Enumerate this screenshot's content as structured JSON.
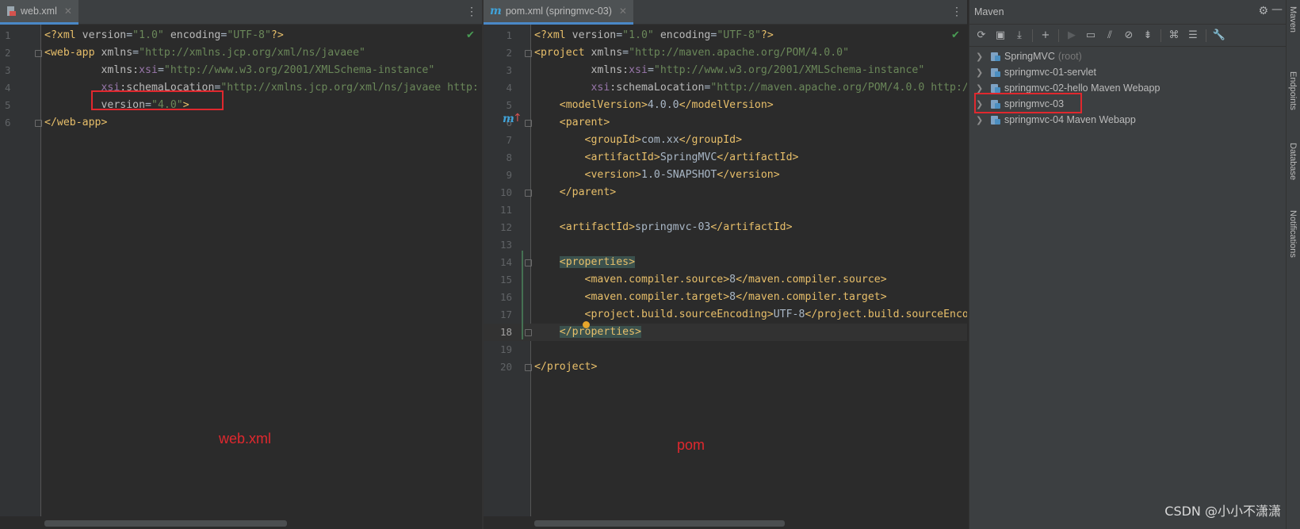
{
  "left_editor": {
    "tab_label": "web.xml",
    "lines": [
      {
        "n": "1",
        "parts": [
          [
            "t-tag",
            "<?xml "
          ],
          [
            "t-attr",
            "version"
          ],
          [
            "t-text",
            "="
          ],
          [
            "t-val",
            "\"1.0\""
          ],
          [
            "t-text",
            " "
          ],
          [
            "t-attr",
            "encoding"
          ],
          [
            "t-text",
            "="
          ],
          [
            "t-val",
            "\"UTF-8\""
          ],
          [
            "t-tag",
            "?>"
          ]
        ]
      },
      {
        "n": "2",
        "parts": [
          [
            "t-tag",
            "<web-app "
          ],
          [
            "t-attr",
            "xmlns"
          ],
          [
            "t-text",
            "="
          ],
          [
            "t-val",
            "\"http://xmlns.jcp.org/xml/ns/javaee\""
          ]
        ]
      },
      {
        "n": "3",
        "parts": [
          [
            "t-text",
            "         "
          ],
          [
            "t-attr",
            "xmlns:"
          ],
          [
            "t-ns",
            "xsi"
          ],
          [
            "t-text",
            "="
          ],
          [
            "t-val",
            "\"http://www.w3.org/2001/XMLSchema-instance\""
          ]
        ]
      },
      {
        "n": "4",
        "parts": [
          [
            "t-text",
            "         "
          ],
          [
            "t-ns",
            "xsi"
          ],
          [
            "t-attr",
            ":schemaLocation"
          ],
          [
            "t-text",
            "="
          ],
          [
            "t-val",
            "\"http://xmlns.jcp.org/xml/ns/javaee http:"
          ]
        ]
      },
      {
        "n": "5",
        "parts": [
          [
            "t-text",
            "         "
          ],
          [
            "t-attr",
            "version"
          ],
          [
            "t-text",
            "="
          ],
          [
            "t-val",
            "\"4.0\""
          ],
          [
            "t-tag",
            ">"
          ]
        ]
      },
      {
        "n": "6",
        "parts": [
          [
            "t-tag",
            "</web-app>"
          ]
        ]
      }
    ],
    "annotation_label": "web.xml"
  },
  "right_editor": {
    "tab_label": "pom.xml (springmvc-03)",
    "current_line": "18",
    "lines": [
      {
        "n": "1",
        "parts": [
          [
            "t-tag",
            "<?xml "
          ],
          [
            "t-attr",
            "version"
          ],
          [
            "t-text",
            "="
          ],
          [
            "t-val",
            "\"1.0\""
          ],
          [
            "t-text",
            " "
          ],
          [
            "t-attr",
            "encoding"
          ],
          [
            "t-text",
            "="
          ],
          [
            "t-val",
            "\"UTF-8\""
          ],
          [
            "t-tag",
            "?>"
          ]
        ]
      },
      {
        "n": "2",
        "parts": [
          [
            "t-tag",
            "<project "
          ],
          [
            "t-attr",
            "xmlns"
          ],
          [
            "t-text",
            "="
          ],
          [
            "t-val",
            "\"http://maven.apache.org/POM/4.0.0\""
          ]
        ]
      },
      {
        "n": "3",
        "parts": [
          [
            "t-text",
            "         "
          ],
          [
            "t-attr",
            "xmlns:"
          ],
          [
            "t-ns",
            "xsi"
          ],
          [
            "t-text",
            "="
          ],
          [
            "t-val",
            "\"http://www.w3.org/2001/XMLSchema-instance\""
          ]
        ]
      },
      {
        "n": "4",
        "parts": [
          [
            "t-text",
            "         "
          ],
          [
            "t-ns",
            "xsi"
          ],
          [
            "t-attr",
            ":schemaLocation"
          ],
          [
            "t-text",
            "="
          ],
          [
            "t-val",
            "\"http://maven.apache.org/POM/4.0.0 http:/"
          ]
        ]
      },
      {
        "n": "5",
        "parts": [
          [
            "t-text",
            "    "
          ],
          [
            "t-tag",
            "<modelVersion>"
          ],
          [
            "t-text",
            "4.0.0"
          ],
          [
            "t-tag",
            "</modelVersion>"
          ]
        ]
      },
      {
        "n": "6",
        "parts": [
          [
            "t-text",
            "    "
          ],
          [
            "t-tag",
            "<parent>"
          ]
        ]
      },
      {
        "n": "7",
        "parts": [
          [
            "t-text",
            "        "
          ],
          [
            "t-tag",
            "<groupId>"
          ],
          [
            "t-text",
            "com.xx"
          ],
          [
            "t-tag",
            "</groupId>"
          ]
        ]
      },
      {
        "n": "8",
        "parts": [
          [
            "t-text",
            "        "
          ],
          [
            "t-tag",
            "<artifactId>"
          ],
          [
            "t-text",
            "SpringMVC"
          ],
          [
            "t-tag",
            "</artifactId>"
          ]
        ]
      },
      {
        "n": "9",
        "parts": [
          [
            "t-text",
            "        "
          ],
          [
            "t-tag",
            "<version>"
          ],
          [
            "t-text",
            "1.0-SNAPSHOT"
          ],
          [
            "t-tag",
            "</version>"
          ]
        ]
      },
      {
        "n": "10",
        "parts": [
          [
            "t-text",
            "    "
          ],
          [
            "t-tag",
            "</parent>"
          ]
        ]
      },
      {
        "n": "11",
        "parts": []
      },
      {
        "n": "12",
        "parts": [
          [
            "t-text",
            "    "
          ],
          [
            "t-tag",
            "<artifactId>"
          ],
          [
            "t-text",
            "springmvc-03"
          ],
          [
            "t-tag",
            "</artifactId>"
          ]
        ]
      },
      {
        "n": "13",
        "parts": []
      },
      {
        "n": "14",
        "parts": [
          [
            "t-text",
            "    "
          ],
          [
            "t-tag hl-tag",
            "<properties>"
          ]
        ]
      },
      {
        "n": "15",
        "parts": [
          [
            "t-text",
            "        "
          ],
          [
            "t-tag",
            "<maven.compiler.source>"
          ],
          [
            "t-text",
            "8"
          ],
          [
            "t-tag",
            "</maven.compiler.source>"
          ]
        ]
      },
      {
        "n": "16",
        "parts": [
          [
            "t-text",
            "        "
          ],
          [
            "t-tag",
            "<maven.compiler.target>"
          ],
          [
            "t-text",
            "8"
          ],
          [
            "t-tag",
            "</maven.compiler.target>"
          ]
        ]
      },
      {
        "n": "17",
        "parts": [
          [
            "t-text",
            "        "
          ],
          [
            "t-tag",
            "<project.build.sourceEncoding>"
          ],
          [
            "t-text",
            "UTF-8"
          ],
          [
            "t-tag",
            "</project.build.sourceEnco"
          ]
        ]
      },
      {
        "n": "18",
        "parts": [
          [
            "t-text",
            "    "
          ],
          [
            "t-tag hl-tag",
            "</properties>"
          ]
        ]
      },
      {
        "n": "19",
        "parts": []
      },
      {
        "n": "20",
        "parts": [
          [
            "t-tag",
            "</project>"
          ]
        ]
      }
    ],
    "annotation_label": "pom"
  },
  "maven": {
    "title": "Maven",
    "toolbar_icons": [
      "reload-icon",
      "add-folder-icon",
      "download-icon",
      "plus-icon",
      "run-icon",
      "execute-goal-icon",
      "toggle-offline-icon",
      "skip-tests-icon",
      "collapse-icon",
      "show-dependencies-icon",
      "expand-icon",
      "settings-wrench-icon"
    ],
    "tree": [
      {
        "label": "SpringMVC",
        "suffix": "(root)"
      },
      {
        "label": "springmvc-01-servlet",
        "suffix": ""
      },
      {
        "label": "springmvc-02-hello Maven Webapp",
        "suffix": ""
      },
      {
        "label": "springmvc-03",
        "suffix": ""
      },
      {
        "label": "springmvc-04 Maven Webapp",
        "suffix": ""
      }
    ]
  },
  "side_stripe": [
    "Maven",
    "Endpoints",
    "Database",
    "Notifications"
  ],
  "watermark": "CSDN @小小不潇潇",
  "colors": {
    "annotation_red": "#e0282e",
    "accent_blue": "#4a88c7",
    "check_green": "#499c54"
  }
}
